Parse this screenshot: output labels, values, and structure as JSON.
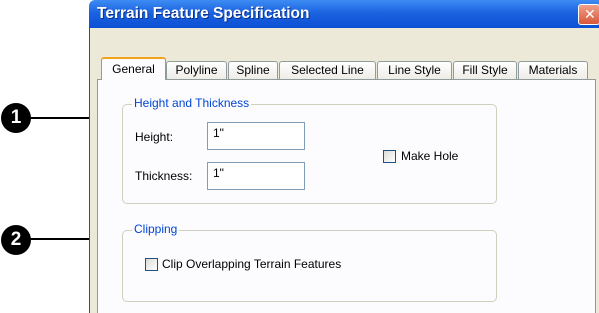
{
  "window": {
    "title": "Terrain Feature Specification",
    "close_glyph": "✕"
  },
  "tabs": [
    {
      "label": "General"
    },
    {
      "label": "Polyline"
    },
    {
      "label": "Spline"
    },
    {
      "label": "Selected Line"
    },
    {
      "label": "Line Style"
    },
    {
      "label": "Fill Style"
    },
    {
      "label": "Materials"
    }
  ],
  "height_thickness": {
    "legend": "Height and Thickness",
    "height_label": "Height:",
    "height_value": "1\"",
    "thickness_label": "Thickness:",
    "thickness_value": "1\"",
    "make_hole_label": "Make Hole",
    "make_hole_checked": false
  },
  "clipping": {
    "legend": "Clipping",
    "clip_label": "Clip Overlapping Terrain Features",
    "clip_checked": false
  },
  "callouts": [
    "1",
    "2"
  ]
}
